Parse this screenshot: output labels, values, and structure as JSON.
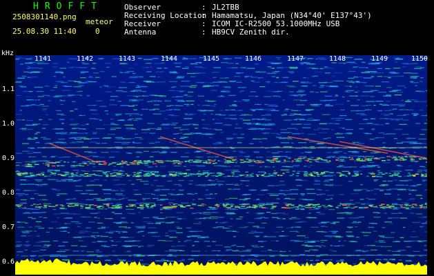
{
  "header": {
    "title": "HROFFT",
    "file_name": "2508301140.png",
    "timestamp": "25.08.30 11:40",
    "meteor_label": "meteor",
    "meteor_count": "0",
    "info": [
      {
        "label": "Observer",
        "value": "JL2TBB"
      },
      {
        "label": "Receiving Location",
        "value": "Hamamatsu, Japan (N34°40' E137°43')"
      },
      {
        "label": "Receiver",
        "value": "ICOM IC-R2500 53.1000MHz USB"
      },
      {
        "label": "Antenna",
        "value": "HB9CV Zenith dir."
      }
    ],
    "colon": ":"
  },
  "axes": {
    "y_unit": "kHz",
    "x_ticks": [
      "1141",
      "1142",
      "1143",
      "1144",
      "1145",
      "1146",
      "1147",
      "1148",
      "1149",
      "1150"
    ],
    "y_ticks": [
      "1.1",
      "1.0",
      "0.9",
      "0.8",
      "0.7",
      "0.6"
    ]
  },
  "colors": {
    "background": "#000000",
    "spectrum": "#001a8a",
    "title": "#00ff00",
    "file_info": "#ffff66",
    "noise_floor": "#ffff00"
  }
}
